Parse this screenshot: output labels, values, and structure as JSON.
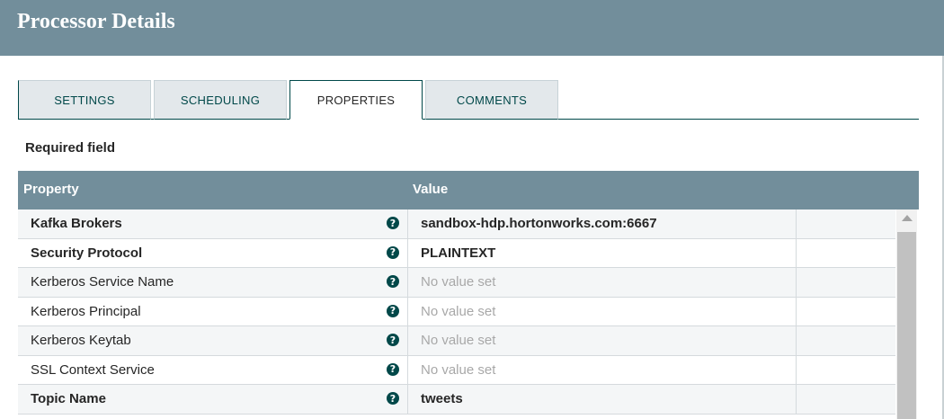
{
  "dialog": {
    "title": "Processor Details"
  },
  "tabs": [
    {
      "label": "SETTINGS",
      "active": false
    },
    {
      "label": "SCHEDULING",
      "active": false
    },
    {
      "label": "PROPERTIES",
      "active": true
    },
    {
      "label": "COMMENTS",
      "active": false
    }
  ],
  "required_label": "Required field",
  "grid": {
    "columns": {
      "property": "Property",
      "value": "Value"
    },
    "rows": [
      {
        "property": "Kafka Brokers",
        "value": "sandbox-hdp.hortonworks.com:6667",
        "required": true,
        "has_value": true
      },
      {
        "property": "Security Protocol",
        "value": "PLAINTEXT",
        "required": true,
        "has_value": true
      },
      {
        "property": "Kerberos Service Name",
        "value": "No value set",
        "required": false,
        "has_value": false
      },
      {
        "property": "Kerberos Principal",
        "value": "No value set",
        "required": false,
        "has_value": false
      },
      {
        "property": "Kerberos Keytab",
        "value": "No value set",
        "required": false,
        "has_value": false
      },
      {
        "property": "SSL Context Service",
        "value": "No value set",
        "required": false,
        "has_value": false
      },
      {
        "property": "Topic Name",
        "value": "tweets",
        "required": true,
        "has_value": true
      }
    ],
    "help_icon": "question-circle-icon"
  },
  "colors": {
    "header_bg": "#728e9b",
    "accent": "#004849",
    "tab_bg": "#e3e8eb",
    "placeholder_text": "#a8a8a8"
  }
}
